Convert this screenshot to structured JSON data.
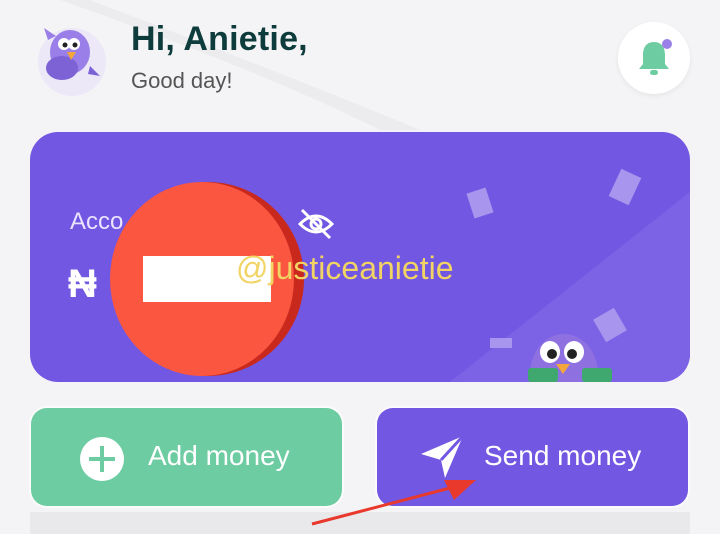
{
  "header": {
    "greeting": "Hi, Anietie,",
    "subgreeting": "Good day!"
  },
  "card": {
    "label": "Acco",
    "currency_symbol": "₦",
    "watermark": "@justiceanietie"
  },
  "actions": {
    "add_money": "Add money",
    "send_money": "Send money"
  },
  "colors": {
    "card": "#7257e2",
    "add_button": "#6dcca2",
    "send_button": "#7257e2",
    "title": "#0e3b3b",
    "bell": "#6dcca2",
    "annotation_red": "#fb5640"
  },
  "icons": [
    "bird-avatar-icon",
    "bell-icon",
    "eye-off-icon",
    "plus-icon",
    "send-icon",
    "red-arrow-icon"
  ]
}
